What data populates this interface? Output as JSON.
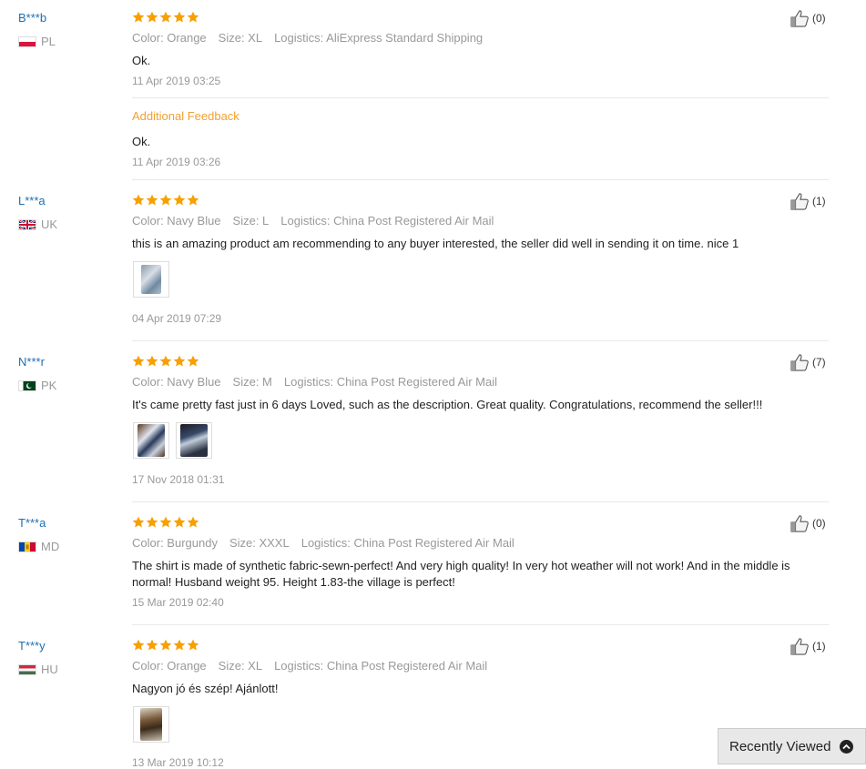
{
  "reviews": [
    {
      "user": "B***b",
      "country": "PL",
      "flag": "pl",
      "color": "Color: Orange",
      "size": "Size: XL",
      "logistics": "Logistics: AliExpress Standard Shipping",
      "text": "Ok.",
      "date": "11 Apr 2019 03:25",
      "likes": "(0)",
      "additional_label": "Additional Feedback",
      "additional_text": "Ok.",
      "additional_date": "11 Apr 2019 03:26"
    },
    {
      "user": "L***a",
      "country": "UK",
      "flag": "uk",
      "color": "Color: Navy Blue",
      "size": "Size: L",
      "logistics": "Logistics: China Post Registered Air Mail",
      "text": "this is an amazing product am recommending to any buyer interested, the seller did well in sending it on time. nice 1",
      "date": "04 Apr 2019 07:29",
      "likes": "(1)"
    },
    {
      "user": "N***r",
      "country": "PK",
      "flag": "pk",
      "color": "Color: Navy Blue",
      "size": "Size: M",
      "logistics": "Logistics: China Post Registered Air Mail",
      "text": "It's came pretty fast just in 6 days Loved, such as the description. Great quality. Congratulations, recommend the seller!!!",
      "date": "17 Nov 2018 01:31",
      "likes": "(7)"
    },
    {
      "user": "T***a",
      "country": "MD",
      "flag": "md",
      "color": "Color: Burgundy",
      "size": "Size: XXXL",
      "logistics": "Logistics: China Post Registered Air Mail",
      "text": "The shirt is made of synthetic fabric-sewn-perfect! And very high quality! In very hot weather will not work! And in the middle is normal! Husband weight 95. Height 1.83-the village is perfect!",
      "date": "15 Mar 2019 02:40",
      "likes": "(0)"
    },
    {
      "user": "T***y",
      "country": "HU",
      "flag": "hu",
      "color": "Color: Orange",
      "size": "Size: XL",
      "logistics": "Logistics: China Post Registered Air Mail",
      "text": "Nagyon jó és szép! Ajánlott!",
      "date": "13 Mar 2019 10:12",
      "likes": "(1)"
    }
  ],
  "recently_viewed": "Recently Viewed",
  "icons": {
    "star": "star-icon",
    "like": "thumbs-up-icon",
    "chevron": "chevron-up-icon"
  },
  "colors": {
    "star": "#f7a000",
    "username": "#1f6fb2",
    "additional": "#f0a030"
  }
}
